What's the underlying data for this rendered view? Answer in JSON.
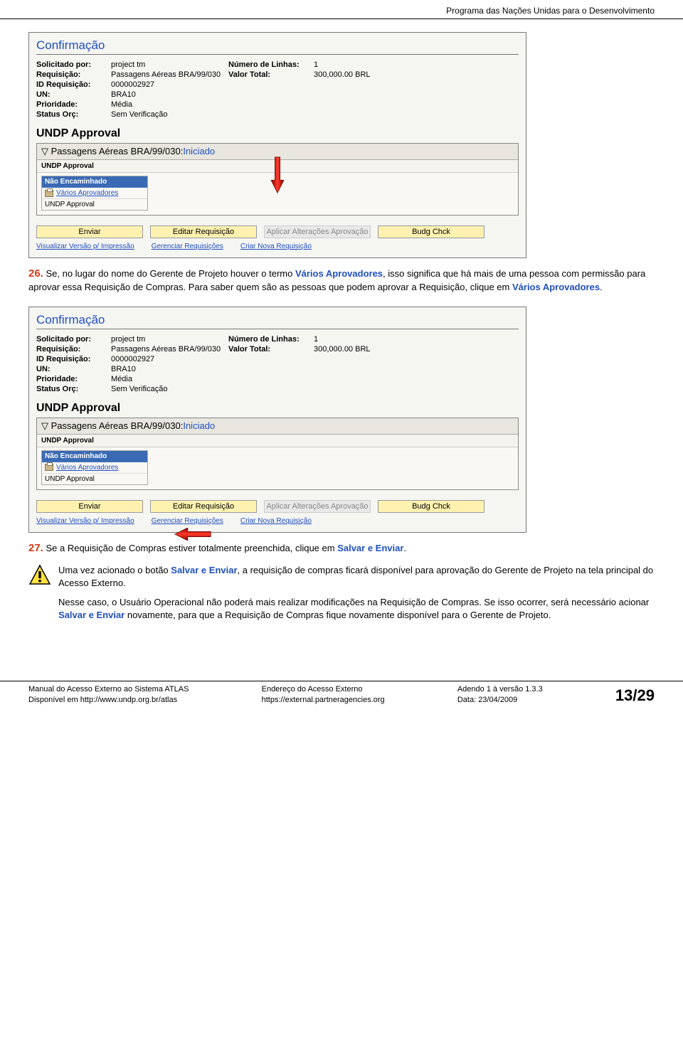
{
  "header": {
    "org": "Programa das Nações Unidas para o Desenvolvimento"
  },
  "shot1": {
    "title": "Confirmação",
    "fields": {
      "solicitado_por_label": "Solicitado por:",
      "solicitado_por": "project tm",
      "requisicao_label": "Requisição:",
      "requisicao": "Passagens Aéreas BRA/99/030",
      "id_req_label": "ID Requisição:",
      "id_req": "0000002927",
      "un_label": "UN:",
      "un": "BRA10",
      "prioridade_label": "Prioridade:",
      "prioridade": "Média",
      "status_label": "Status Orç:",
      "status": "Sem Verificação",
      "num_linhas_label": "Número de Linhas:",
      "num_linhas": "1",
      "valor_total_label": "Valor Total:",
      "valor_total": "300,000.00  BRL"
    },
    "approval": {
      "section_title": "UNDP Approval",
      "head_prefix": "▽ Passagens Aéreas BRA/99/030:",
      "head_status": "Iniciado",
      "sub": "UNDP Approval",
      "tbl_head": "Não Encaminhado",
      "row1": "Vários Aprovadores",
      "row2": "UNDP Approval"
    },
    "buttons": {
      "enviar": "Enviar",
      "editar": "Editar Requisição",
      "aplicar": "Aplicar Alterações Aprovação",
      "budg": "Budg Chck"
    },
    "links": {
      "l1": "Visualizar Versão p/ Impressão",
      "l2": "Gerenciar Requisições",
      "l3": "Criar Nova Requisição"
    }
  },
  "para26": {
    "num": "26.",
    "t1": " Se, no lugar do nome do Gerente de Projeto houver o termo ",
    "term1": "Vários Aprovadores",
    "t2": ", isso significa que há mais de uma pessoa com permissão para aprovar essa Requisição de Compras. Para saber quem são as pessoas que podem aprovar a Requisição, clique em ",
    "term2": "Vários Aprovadores",
    "t3": "."
  },
  "para27": {
    "num": "27.",
    "t1": " Se a Requisição de Compras estiver totalmente preenchida, clique em ",
    "term1": "Salvar e Enviar",
    "t2": "."
  },
  "warn": {
    "p1a": "Uma vez acionado o botão ",
    "p1term": "Salvar e Enviar",
    "p1b": ", a requisição de compras ficará disponível para aprovação do Gerente de Projeto na tela principal do Acesso Externo.",
    "p2a": "Nesse caso, o Usuário Operacional não poderá mais realizar modificações na Requisição de Compras. Se isso ocorrer, será necessário acionar ",
    "p2term": "Salvar e Enviar",
    "p2b": " novamente, para que a Requisição de Compras fique novamente disponível para o Gerente de Projeto."
  },
  "footer": {
    "c1a": "Manual do Acesso Externo ao Sistema ATLAS",
    "c1b": "Disponível em http://www.undp.org.br/atlas",
    "c2a": "Endereço do Acesso Externo",
    "c2b": "https://external.partneragencies.org",
    "c3a": "Adendo 1 à versão 1.3.3",
    "c3b": "Data: 23/04/2009",
    "page": "13/29"
  }
}
